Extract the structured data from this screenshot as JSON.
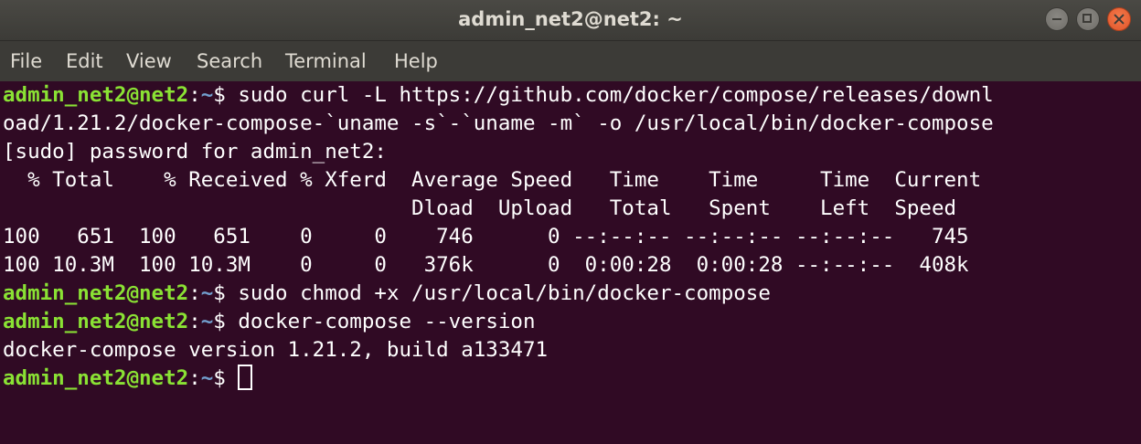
{
  "window": {
    "title": "admin_net2@net2: ~"
  },
  "menu": {
    "file": "File",
    "edit": "Edit",
    "view": "View",
    "search": "Search",
    "terminal": "Terminal",
    "help": "Help"
  },
  "colors": {
    "background": "#300a24",
    "prompt_user": "#8ae234",
    "prompt_path": "#729fcf",
    "text": "#ffffff",
    "titlebar": "#3c3b37",
    "close_button": "#e95420"
  },
  "prompt": {
    "user_host": "admin_net2@net2",
    "separator": ":",
    "path": "~",
    "symbol": "$ "
  },
  "lines": {
    "l1_cmd": "sudo curl -L https://github.com/docker/compose/releases/downl",
    "l2": "oad/1.21.2/docker-compose-`uname -s`-`uname -m` -o /usr/local/bin/docker-compose",
    "l3": "[sudo] password for admin_net2:",
    "l4": "  % Total    % Received % Xferd  Average Speed   Time    Time     Time  Current",
    "l5": "                                 Dload  Upload   Total   Spent    Left  Speed",
    "l6": "100   651  100   651    0     0    746      0 --:--:-- --:--:-- --:--:--   745",
    "l7": "100 10.3M  100 10.3M    0     0   376k      0  0:00:28  0:00:28 --:--:--  408k",
    "l8_cmd": "sudo chmod +x /usr/local/bin/docker-compose",
    "l9_cmd": "docker-compose --version",
    "l10": "docker-compose version 1.21.2, build a133471",
    "l11_cmd": ""
  }
}
